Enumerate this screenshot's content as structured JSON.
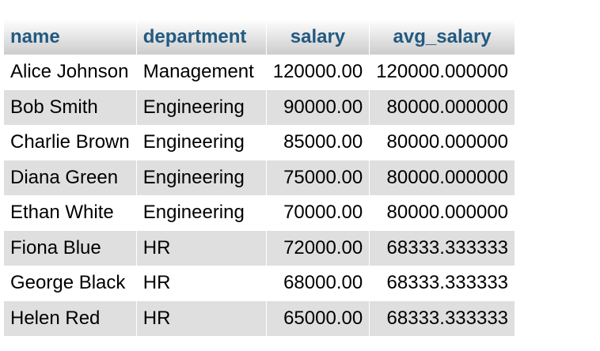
{
  "results_table": {
    "columns": [
      {
        "key": "name",
        "label": "name"
      },
      {
        "key": "department",
        "label": "department"
      },
      {
        "key": "salary",
        "label": "salary"
      },
      {
        "key": "avg_salary",
        "label": "avg_salary"
      }
    ],
    "rows": [
      {
        "name": "Alice Johnson",
        "department": "Management",
        "salary": "120000.00",
        "avg_salary": "120000.000000"
      },
      {
        "name": "Bob Smith",
        "department": "Engineering",
        "salary": "90000.00",
        "avg_salary": "80000.000000"
      },
      {
        "name": "Charlie Brown",
        "department": "Engineering",
        "salary": "85000.00",
        "avg_salary": "80000.000000"
      },
      {
        "name": "Diana Green",
        "department": "Engineering",
        "salary": "75000.00",
        "avg_salary": "80000.000000"
      },
      {
        "name": "Ethan White",
        "department": "Engineering",
        "salary": "70000.00",
        "avg_salary": "80000.000000"
      },
      {
        "name": "Fiona Blue",
        "department": "HR",
        "salary": "72000.00",
        "avg_salary": "68333.333333"
      },
      {
        "name": "George Black",
        "department": "HR",
        "salary": "68000.00",
        "avg_salary": "68333.333333"
      },
      {
        "name": "Helen Red",
        "department": "HR",
        "salary": "65000.00",
        "avg_salary": "68333.333333"
      }
    ]
  },
  "colors": {
    "header_text": "#235a81",
    "row_even": "#dfdfdf",
    "row_odd": "#ffffff"
  }
}
